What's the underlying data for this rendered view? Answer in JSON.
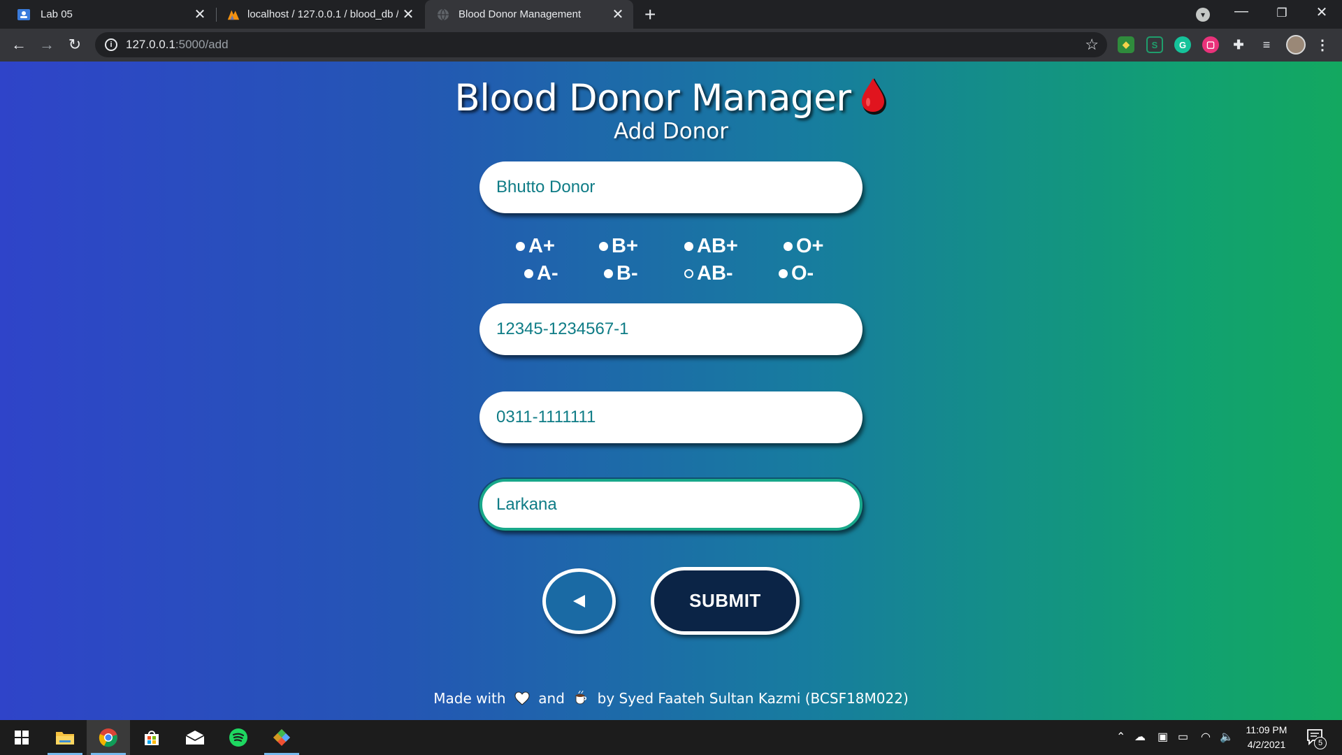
{
  "browser": {
    "tabs": [
      {
        "title": "Lab 05",
        "active": false
      },
      {
        "title": "localhost / 127.0.0.1 / blood_db /",
        "active": false
      },
      {
        "title": "Blood Donor Management",
        "active": true
      }
    ],
    "url_host": "127.0.0.1",
    "url_path": ":5000/add"
  },
  "header": {
    "title": "Blood Donor Manager",
    "subtitle": "Add Donor"
  },
  "form": {
    "name_value": "Bhutto Donor",
    "blood_groups_row1": [
      "A+",
      "B+",
      "AB+",
      "O+"
    ],
    "blood_groups_row2": [
      "A-",
      "B-",
      "AB-",
      "O-"
    ],
    "cnic_value": "12345-1234567-1",
    "phone_value": "0311-1111111",
    "city_value": "Larkana",
    "submit_label": "SUBMIT"
  },
  "footer": {
    "made_with": "Made with",
    "and": "and",
    "by": "by Syed Faateh Sultan Kazmi (BCSF18M022)"
  },
  "taskbar": {
    "time": "11:09 PM",
    "date": "4/2/2021",
    "notification_count": "5"
  },
  "colors": {
    "gradient_left": "#2f44c9",
    "gradient_right": "#13a860",
    "field_text": "#0f7c86",
    "submit_bg": "#0b2446",
    "drop_red": "#e0141e"
  }
}
